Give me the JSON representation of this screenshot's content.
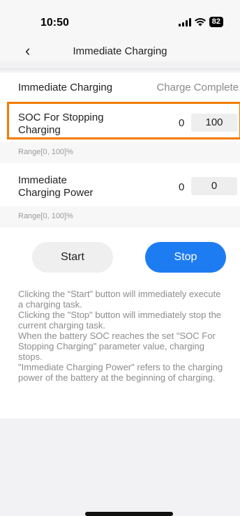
{
  "status_bar": {
    "time": "10:50",
    "battery": "82"
  },
  "nav": {
    "back_icon": "chevron-left-icon",
    "title": "Immediate Charging"
  },
  "charging_status": {
    "label": "Immediate Charging",
    "value": "Charge Complete"
  },
  "soc_stop": {
    "label_line1": "SOC For Stopping",
    "label_line2": "Charging",
    "min": "0",
    "value": "100",
    "range": "Range[0, 100]%"
  },
  "power": {
    "label_line1": "Immediate",
    "label_line2": "Charging Power",
    "min": "0",
    "value": "0",
    "range": "Range[0, 100]%"
  },
  "buttons": {
    "start": "Start",
    "stop": "Stop"
  },
  "description": [
    "Clicking the “Start” button will immediately execute a charging task.",
    "Clicking the \"Stop\" button will immediately stop the current charging task.",
    "When the battery SOC reaches the set \"SOC For Stopping Charging\" parameter value, charging stops.",
    "\"Immediate Charging Power\" refers to the charging power of the battery at the beginning of charging."
  ],
  "colors": {
    "highlight": "#f07d00",
    "accent": "#1e7cf2"
  }
}
